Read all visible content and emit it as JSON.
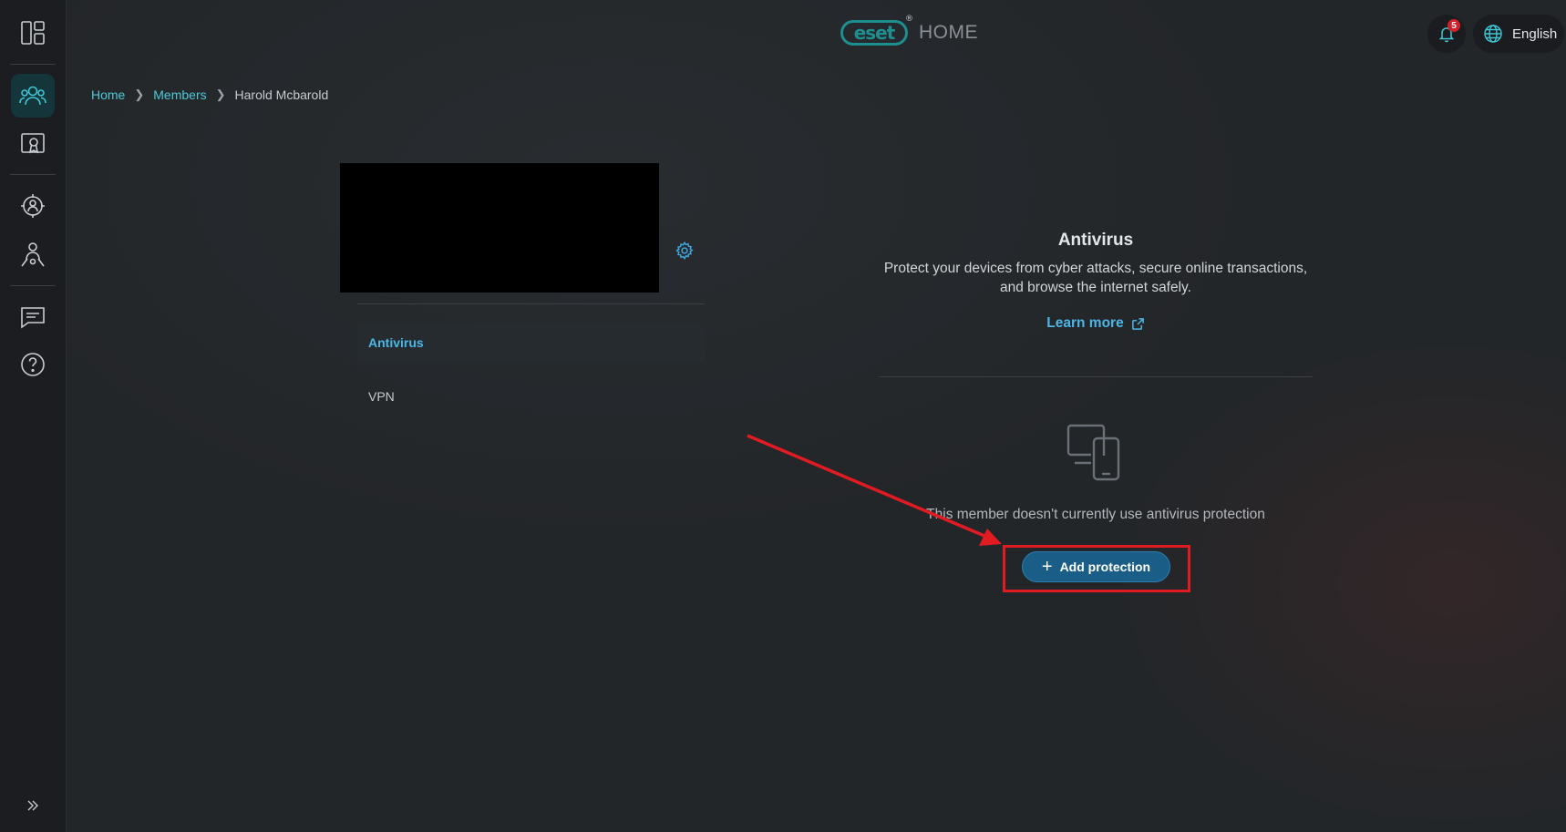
{
  "app": {
    "logo_text": "eset",
    "logo_reg": "®",
    "logo_suffix": "HOME"
  },
  "header": {
    "notification_count": "5",
    "language": "English"
  },
  "sidebar": {
    "items": [
      {
        "icon": "dashboard-icon",
        "active": false
      },
      {
        "icon": "members-icon",
        "active": true
      },
      {
        "icon": "license-icon",
        "active": false
      },
      {
        "icon": "security-icon",
        "active": false
      },
      {
        "icon": "family-icon",
        "active": false
      },
      {
        "icon": "chat-icon",
        "active": false
      },
      {
        "icon": "help-icon",
        "active": false
      }
    ],
    "expand_icon": "double-chevron-right-icon"
  },
  "breadcrumb": {
    "items": [
      "Home",
      "Members"
    ],
    "current": "Harold Mcbarold"
  },
  "member_menu": {
    "items": [
      {
        "label": "Antivirus",
        "active": true
      },
      {
        "label": "VPN",
        "active": false
      }
    ]
  },
  "antivirus": {
    "title": "Antivirus",
    "description": "Protect your devices from cyber attacks, secure online transactions, and browse the internet safely.",
    "learn_more": "Learn more",
    "empty_state": "This member doesn't currently use antivirus protection",
    "add_button": "Add protection"
  },
  "colors": {
    "accent": "#4cb6e6",
    "brand": "#1e8f8f",
    "button": "#1a5d86",
    "annotation": "#e01b22"
  }
}
